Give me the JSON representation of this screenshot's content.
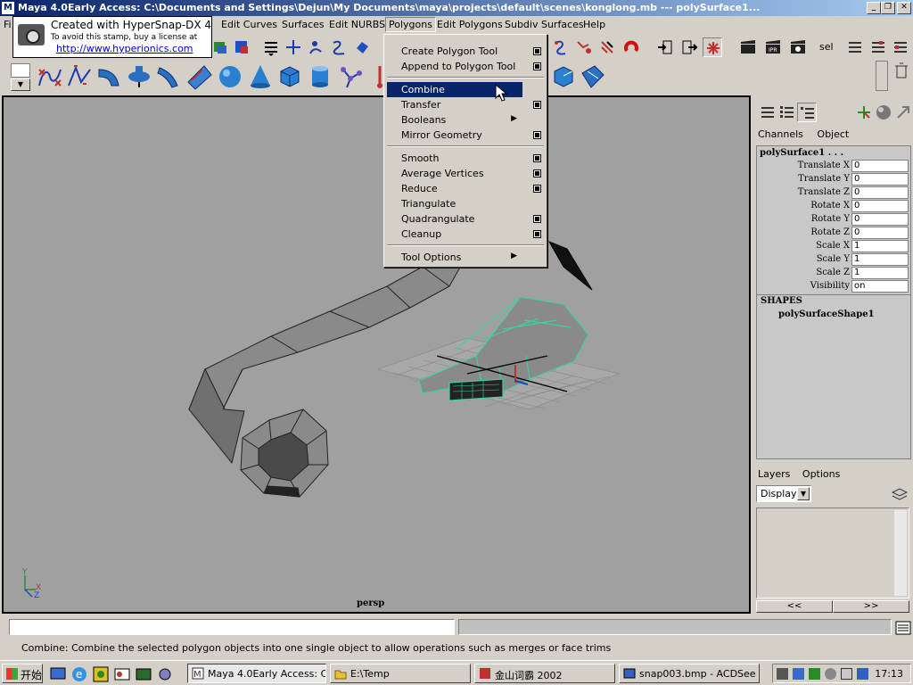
{
  "window": {
    "title": "Maya 4.0Early Access: C:\\Documents and Settings\\Dejun\\My Documents\\maya\\projects\\default\\scenes\\konglong.mb  ---  polySurface1...",
    "icon": "maya-icon",
    "controls": [
      "minimize",
      "restore",
      "close"
    ]
  },
  "stamp": {
    "line1": "Created with HyperSnap-DX 4",
    "line2": "To avoid this stamp, buy a license at",
    "line3": "http://www.hyperionics.com"
  },
  "menubar": {
    "items": [
      "Fi",
      "Edit Curves",
      "Surfaces",
      "Edit NURBS",
      "Polygons",
      "Edit Polygons",
      "Subdiv Surfaces",
      "Help"
    ],
    "active": "Polygons"
  },
  "shelf_top": {
    "sel_label": "sel"
  },
  "polygons_menu": {
    "items": [
      {
        "label": "Create Polygon Tool",
        "option": true,
        "submenu": false
      },
      {
        "label": "Append to Polygon Tool",
        "option": true,
        "submenu": false
      },
      {
        "separator": true
      },
      {
        "label": "Combine",
        "option": false,
        "submenu": false,
        "highlighted": true
      },
      {
        "label": "Transfer",
        "option": true,
        "submenu": false
      },
      {
        "label": "Booleans",
        "option": false,
        "submenu": true
      },
      {
        "label": "Mirror Geometry",
        "option": true,
        "submenu": false
      },
      {
        "separator": true
      },
      {
        "label": "Smooth",
        "option": true,
        "submenu": false
      },
      {
        "label": "Average Vertices",
        "option": true,
        "submenu": false
      },
      {
        "label": "Reduce",
        "option": true,
        "submenu": false
      },
      {
        "label": "Triangulate",
        "option": false,
        "submenu": false
      },
      {
        "label": "Quadrangulate",
        "option": true,
        "submenu": false
      },
      {
        "label": "Cleanup",
        "option": true,
        "submenu": false
      },
      {
        "separator": true
      },
      {
        "label": "Tool Options",
        "option": false,
        "submenu": true
      }
    ]
  },
  "viewport": {
    "camera_label": "persp",
    "axis_labels": {
      "y": "Y",
      "x": "X",
      "z": "Z"
    }
  },
  "channel_box": {
    "tabs": [
      "Channels",
      "Object"
    ],
    "object_name": "polySurface1 . . .",
    "attributes": [
      {
        "name": "Translate X",
        "value": "0"
      },
      {
        "name": "Translate Y",
        "value": "0"
      },
      {
        "name": "Translate Z",
        "value": "0"
      },
      {
        "name": "Rotate X",
        "value": "0"
      },
      {
        "name": "Rotate Y",
        "value": "0"
      },
      {
        "name": "Rotate Z",
        "value": "0"
      },
      {
        "name": "Scale X",
        "value": "1"
      },
      {
        "name": "Scale Y",
        "value": "1"
      },
      {
        "name": "Scale Z",
        "value": "1"
      },
      {
        "name": "Visibility",
        "value": "on"
      }
    ],
    "shapes_header": "SHAPES",
    "shape_name": "polySurfaceShape1"
  },
  "layers": {
    "tabs": [
      "Layers",
      "Options"
    ],
    "display_value": "Display",
    "nav_prev": "<<",
    "nav_next": ">>"
  },
  "command_line": {
    "value": "",
    "result": ""
  },
  "help_line": "Combine: Combine the selected polygon objects into one single object to allow operations such as merges or face trims",
  "taskbar": {
    "start_label": "开始",
    "tasks": [
      {
        "label": "Maya 4.0Early Access: C...",
        "active": true
      },
      {
        "label": "E:\\Temp",
        "active": false
      },
      {
        "label": "金山词霸 2002",
        "active": false
      },
      {
        "label": "snap003.bmp - ACDSee ...",
        "active": false
      }
    ],
    "clock": "17:13"
  },
  "colors": {
    "titlebar": "#0a246a",
    "menu_highlight": "#0a246a",
    "viewport_bg": "#a0a0a0",
    "selection_wire": "#40d0a0"
  }
}
